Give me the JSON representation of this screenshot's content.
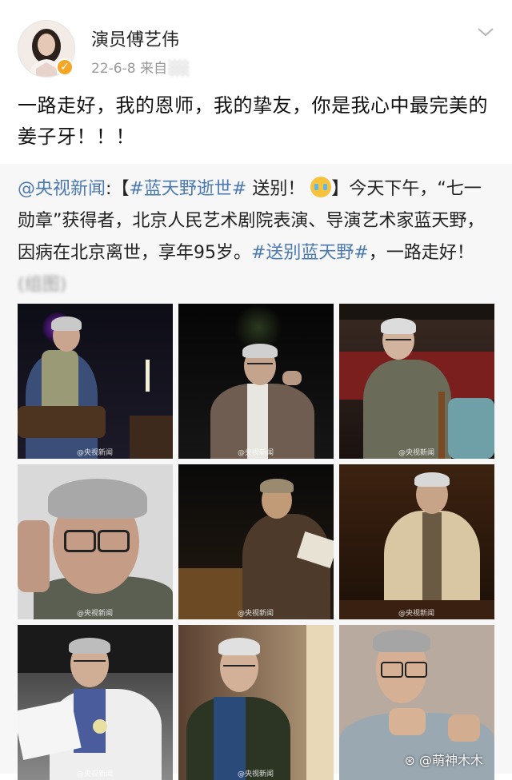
{
  "post": {
    "username": "演员傅艺伟",
    "date": "22-6-8",
    "source_prefix": "来自",
    "source_hidden": "░░",
    "text": "一路走好，我的恩师，我的挚友，你是我心中最完美的姜子牙！！！"
  },
  "repost": {
    "author": "@央视新闻",
    "colon": ":",
    "bracket_open": "【",
    "topic1": "#蓝天野逝世#",
    "text1": " 送别！",
    "bracket_close": "】今天下午，“七一勋章”获得者，北京人民艺术剧院表演、导演艺术家蓝天野，因病在北京离世，享年95岁。",
    "topic2": "#送别蓝天野#",
    "text2": "，一路走好！",
    "blurred_tail": "(组图)"
  },
  "photos": {
    "watermark": "@央视新闻",
    "footer_watermark": "@萌神木木"
  },
  "icons": {
    "verified": "verified-badge-icon",
    "menu": "chevron-down-icon",
    "emoji": "crying-emoji-icon",
    "weibo": "weibo-icon"
  },
  "colors": {
    "link": "#4b7ab3",
    "verified": "#f5a623",
    "repost_bg": "#f7f7f7"
  }
}
